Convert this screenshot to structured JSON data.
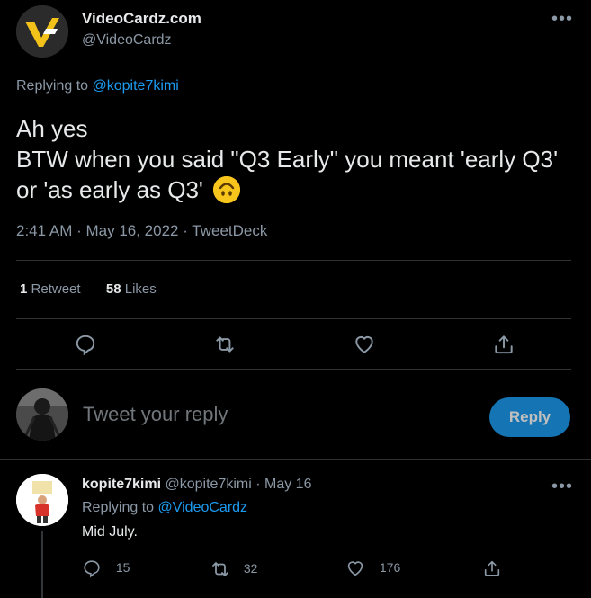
{
  "tweet": {
    "author_name": "VideoCardz.com",
    "author_handle": "@VideoCardz",
    "replying_prefix": "Replying to",
    "replying_to": "@kopite7kimi",
    "text_line1": "Ah yes",
    "text_line2": "BTW when you said \"Q3 Early\" you meant 'early Q3' or 'as early as Q3'",
    "emoji": "upside-down-face",
    "timestamp": "2:41 AM · May 16, 2022 · TweetDeck",
    "retweet_count": "1",
    "retweet_label": "Retweet",
    "like_count": "58",
    "like_label": "Likes"
  },
  "composer": {
    "placeholder": "Tweet your reply",
    "button_label": "Reply"
  },
  "reply": {
    "author_name": "kopite7kimi",
    "author_handle": "@kopite7kimi",
    "date": "· May 16",
    "replying_prefix": "Replying to",
    "replying_to": "@VideoCardz",
    "text": "Mid July.",
    "reply_count": "15",
    "retweet_count": "32",
    "like_count": "176"
  },
  "colors": {
    "background": "#000000",
    "text": "#e7e9ea",
    "muted": "#8b98a5",
    "accent": "#1d9bf0"
  }
}
